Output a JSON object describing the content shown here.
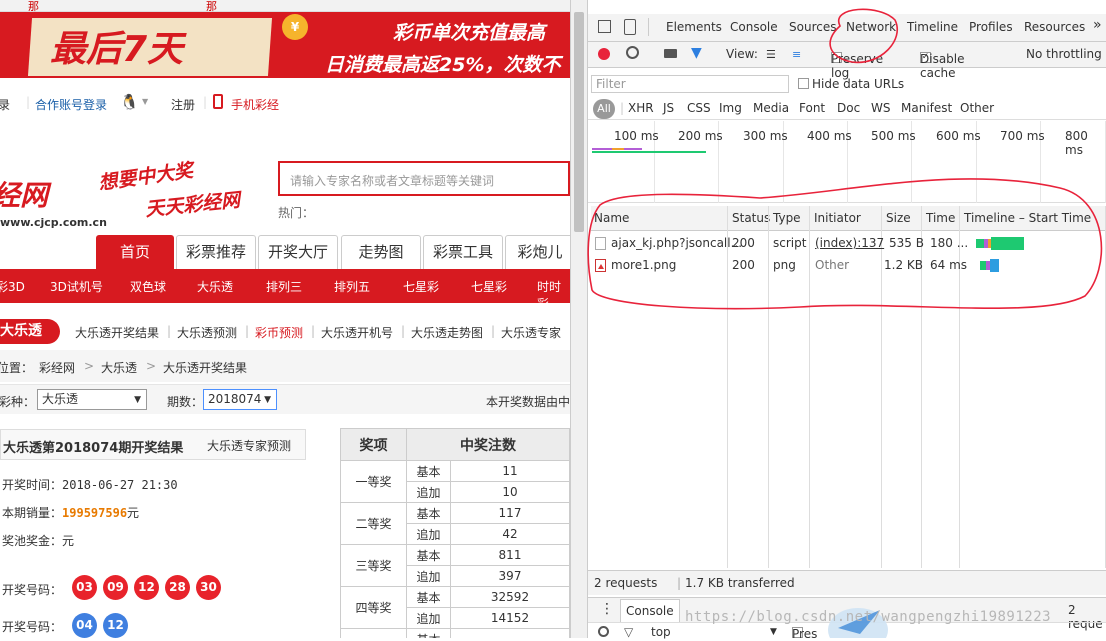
{
  "site": {
    "banner": {
      "top_tab_1": "那",
      "top_tab_2": "那",
      "headline": "最后7天",
      "coin": "¥",
      "promo_line_1": "彩币单次充值最高",
      "promo_line_2": "日消费最高返25%，次数不"
    },
    "topnav": {
      "edge": "录",
      "qq_login": "合作账号登录",
      "register": "注册",
      "mobile": "手机彩经"
    },
    "logo": {
      "name": "经网",
      "url": "www.cjcp.com.cn"
    },
    "slogan": {
      "line1": "想要中大奖",
      "line2": "天天彩经网"
    },
    "search": {
      "placeholder": "请输入专家名称或者文章标题等关键词",
      "hot_label": "热门："
    },
    "main_nav": [
      "首页",
      "彩票推荐",
      "开奖大厅",
      "走势图",
      "彩票工具",
      "彩炮儿"
    ],
    "lottery_bar": [
      "彩3D",
      "3D试机号",
      "双色球",
      "大乐透",
      "排列三",
      "排列五",
      "七星彩",
      "七星彩",
      "时时彩"
    ],
    "sub_nav": {
      "tag": "大乐透",
      "items": [
        "大乐透开奖结果",
        "大乐透预测",
        "彩币预测",
        "大乐透开机号",
        "大乐透走势图",
        "大乐透专家"
      ]
    },
    "breadcrumb": {
      "label": "位置：",
      "items": [
        "彩经网",
        "大乐透",
        "大乐透开奖结果"
      ],
      "sep": ">"
    },
    "filter": {
      "type_label": "彩种：",
      "type_value": "大乐透",
      "issue_label": "期数：",
      "issue_value": "2018074",
      "source_note": "本开奖数据由中"
    },
    "result": {
      "title": "大乐透第2018074期开奖结果",
      "predict_link": "大乐透专家预测",
      "draw_time_label": "开奖时间：",
      "draw_time": "2018-06-27 21:30",
      "sales_label": "本期销量：",
      "sales": "199597596",
      "sales_unit": "元",
      "pool_label": "奖池奖金：",
      "pool_unit": "元",
      "numbers_label": "开奖号码：",
      "red_balls": [
        "03",
        "09",
        "12",
        "28",
        "30"
      ],
      "blue_balls": [
        "04",
        "12"
      ]
    },
    "prize_table": {
      "headers": [
        "奖项",
        "中奖注数"
      ],
      "rows": [
        {
          "level": "一等奖",
          "basic_label": "基本",
          "basic": "11",
          "extra_label": "追加",
          "extra": "10"
        },
        {
          "level": "二等奖",
          "basic_label": "基本",
          "basic": "117",
          "extra_label": "追加",
          "extra": "42"
        },
        {
          "level": "三等奖",
          "basic_label": "基本",
          "basic": "811",
          "extra_label": "追加",
          "extra": "397"
        },
        {
          "level": "四等奖",
          "basic_label": "基本",
          "basic": "32592",
          "extra_label": "追加",
          "extra": "14152"
        }
      ],
      "partial_row": "基本"
    }
  },
  "devtools": {
    "tabs": [
      "Elements",
      "Console",
      "Sources",
      "Network",
      "Timeline",
      "Profiles",
      "Resources"
    ],
    "more": "»",
    "toolbar": {
      "view_label": "View:",
      "preserve_log": "Preserve log",
      "disable_cache": "Disable cache",
      "throttling": "No throttling"
    },
    "filter_placeholder": "Filter",
    "hide_data_urls": "Hide data URLs",
    "types": [
      "All",
      "XHR",
      "JS",
      "CSS",
      "Img",
      "Media",
      "Font",
      "Doc",
      "WS",
      "Manifest",
      "Other"
    ],
    "ticks": [
      "100 ms",
      "200 ms",
      "300 ms",
      "400 ms",
      "500 ms",
      "600 ms",
      "700 ms",
      "800 ms"
    ],
    "columns": [
      "Name",
      "Status",
      "Type",
      "Initiator",
      "Size",
      "Time",
      "Timeline – Start Time"
    ],
    "requests": [
      {
        "name": "ajax_kj.php?jsoncall...",
        "status": "200",
        "type": "script",
        "initiator": "(index):137",
        "size": "535 B",
        "time": "180 ..."
      },
      {
        "name": "more1.png",
        "status": "200",
        "type": "png",
        "initiator": "Other",
        "size": "1.2 KB",
        "time": "64 ms"
      }
    ],
    "summary_requests": "2 requests",
    "summary_sep": "|",
    "summary_transferred": "1.7 KB transferred",
    "drawer": {
      "menu": "⋮",
      "console_tab": "Console",
      "right": "2 reque"
    },
    "console_context": "top",
    "console_right": "Pres",
    "colors": {
      "record": "#e8233b",
      "waterfall_green": "#1ec971",
      "waterfall_blue": "#2d9de0",
      "annotation": "#e8233b"
    }
  },
  "watermark": "https://blog.csdn.net/wangpengzhi19891223"
}
